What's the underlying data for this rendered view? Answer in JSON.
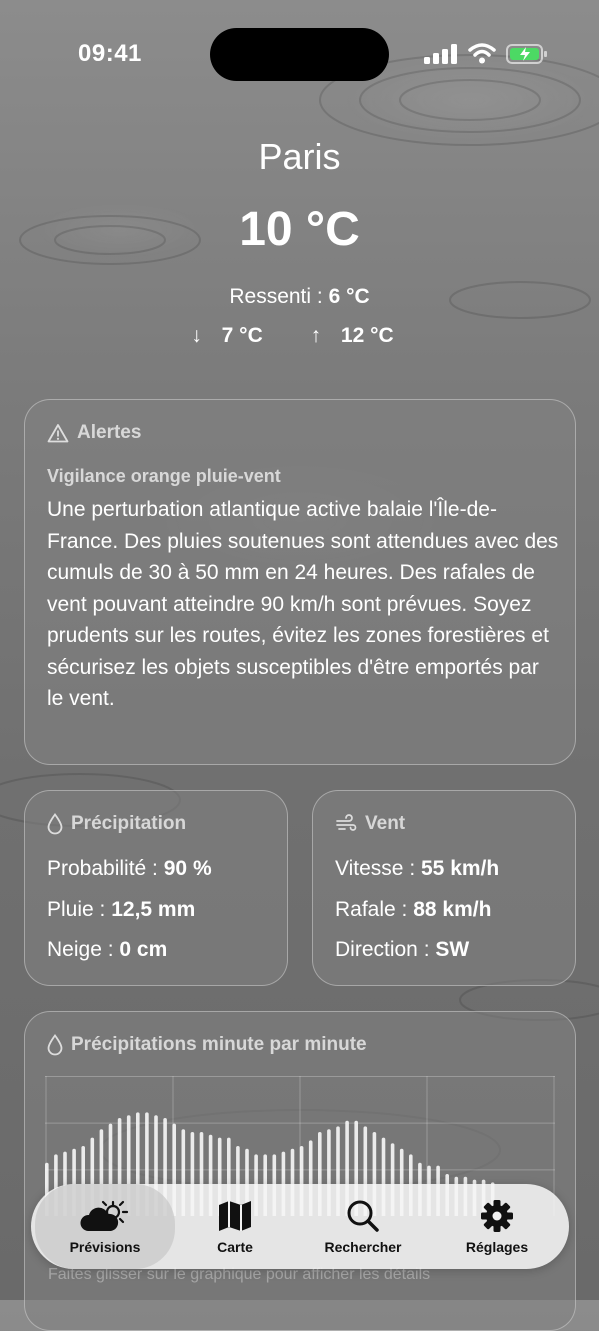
{
  "status": {
    "time": "09:41"
  },
  "weather": {
    "city": "Paris",
    "temperature": "10 °C",
    "feels_label": "Ressenti :",
    "feels_value": "6 °C",
    "min": "7 °C",
    "max": "12 °C"
  },
  "alert": {
    "title": "Alertes",
    "subtitle": "Vigilance orange pluie-vent",
    "body": "Une perturbation atlantique active balaie l'Île-de-France. Des pluies soutenues sont attendues avec des cumuls de 30 à 50 mm en 24 heures. Des rafales de vent pouvant atteindre 90 km/h sont prévues. Soyez prudents sur les routes, évitez les zones forestières et sécurisez les objets susceptibles d'être emportés par le vent."
  },
  "precipitation": {
    "title": "Précipitation",
    "probability_label": "Probabilité :",
    "probability_value": "90 %",
    "rain_label": "Pluie :",
    "rain_value": "12,5 mm",
    "snow_label": "Neige :",
    "snow_value": "0 cm"
  },
  "wind": {
    "title": "Vent",
    "speed_label": "Vitesse :",
    "speed_value": "55 km/h",
    "gust_label": "Rafale :",
    "gust_value": "88 km/h",
    "direction_label": "Direction :",
    "direction_value": "SW"
  },
  "minute_chart": {
    "title": "Précipitations minute par minute"
  },
  "chart_data": {
    "type": "bar",
    "title": "Précipitations minute par minute",
    "values": [
      0.38,
      0.44,
      0.46,
      0.48,
      0.5,
      0.56,
      0.62,
      0.66,
      0.7,
      0.72,
      0.74,
      0.74,
      0.72,
      0.7,
      0.66,
      0.62,
      0.6,
      0.6,
      0.58,
      0.56,
      0.56,
      0.5,
      0.48,
      0.44,
      0.44,
      0.44,
      0.46,
      0.48,
      0.5,
      0.54,
      0.6,
      0.62,
      0.64,
      0.68,
      0.68,
      0.64,
      0.6,
      0.56,
      0.52,
      0.48,
      0.44,
      0.38,
      0.36,
      0.36,
      0.3,
      0.28,
      0.28,
      0.26,
      0.26,
      0.24
    ]
  },
  "hint": "Faites glisser sur le graphique pour afficher les détails",
  "tabs": [
    {
      "label": "Prévisions",
      "icon": "cloud-sun-icon"
    },
    {
      "label": "Carte",
      "icon": "map-icon"
    },
    {
      "label": "Rechercher",
      "icon": "search-icon"
    },
    {
      "label": "Réglages",
      "icon": "gear-icon"
    }
  ]
}
